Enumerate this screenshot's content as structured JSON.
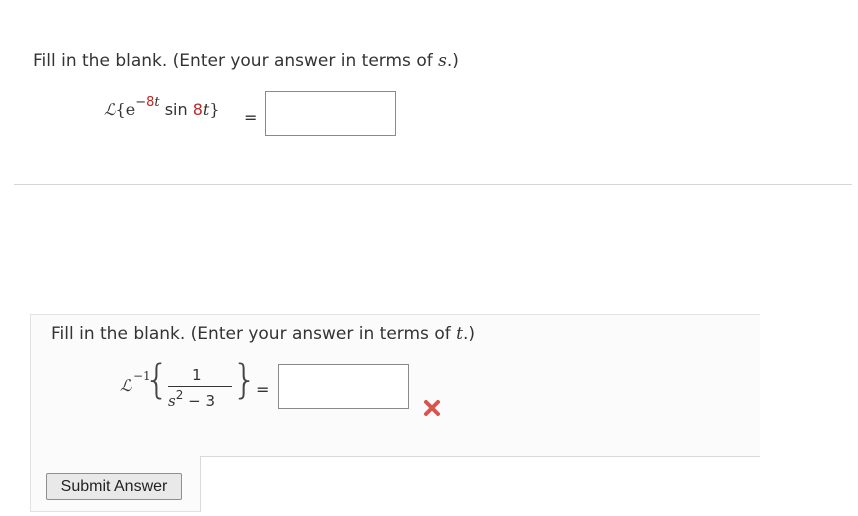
{
  "question1": {
    "instruction_prefix": "Fill in the blank. (Enter your answer in terms of ",
    "variable": "s",
    "instruction_suffix": ".)",
    "laplace_symbol": "ℒ",
    "open_brace": "{e",
    "exponent_sign": "−",
    "exponent_coef": "8",
    "exponent_var": "t",
    "func": "sin",
    "arg_coef": "8",
    "arg_var": "t",
    "close_brace": "}",
    "equals": "=",
    "answer_value": ""
  },
  "question2": {
    "instruction_prefix": "Fill in the blank. (Enter your answer in terms of ",
    "variable": "t",
    "instruction_suffix": ".)",
    "laplace_symbol": "ℒ",
    "inverse": "−1",
    "left_brace": "{",
    "right_brace": "}",
    "numerator": "1",
    "den_var": "s",
    "den_power": "2",
    "den_rest": " − 3",
    "equals": "=",
    "answer_value": "",
    "status_icon": "x-mark-icon",
    "status_color": "#d9534f"
  },
  "submit": {
    "label": "Submit Answer"
  }
}
